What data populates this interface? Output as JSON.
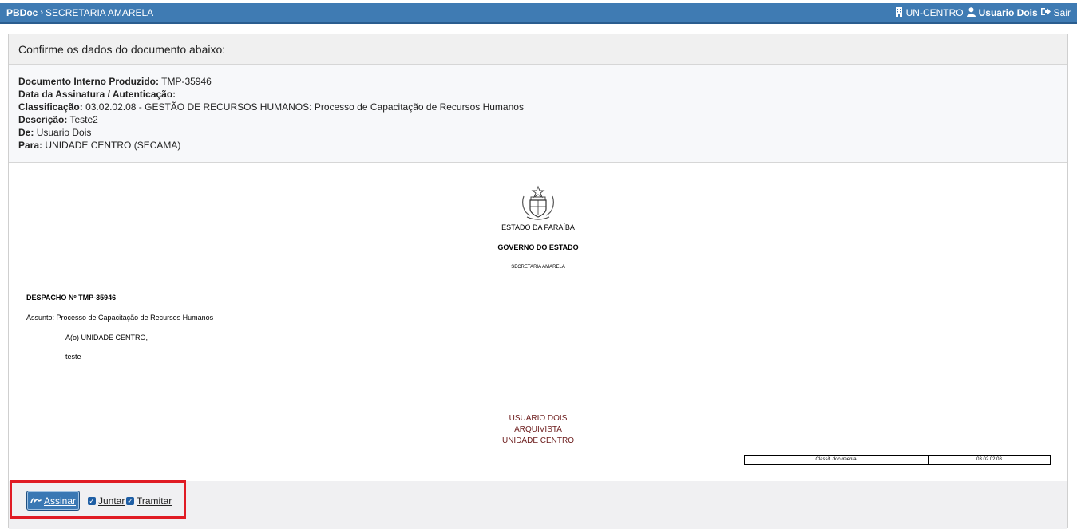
{
  "topbar": {
    "brand": "PBDoc",
    "section": "SECRETARIA AMARELA",
    "unit": "UN-CENTRO",
    "user": "Usuario Dois",
    "logout": "Sair"
  },
  "card": {
    "title": "Confirme os dados do documento abaixo:"
  },
  "meta": {
    "doc_label": "Documento Interno Produzido:",
    "doc_value": "TMP-35946",
    "date_label": "Data da Assinatura / Autenticação:",
    "class_label": "Classificação:",
    "class_value": "03.02.02.08 - GESTÃO DE RECURSOS HUMANOS: Processo de Capacitação de Recursos Humanos",
    "desc_label": "Descrição:",
    "desc_value": "Teste2",
    "from_label": "De:",
    "from_value": "Usuario Dois",
    "to_label": "Para:",
    "to_value": "UNIDADE CENTRO (SECAMA)"
  },
  "document": {
    "state": "ESTADO DA PARAÍBA",
    "government": "GOVERNO DO ESTADO",
    "secretariat": "SECRETARIA AMARELA",
    "despacho": "DESPACHO Nº TMP-35946",
    "assunto": "Assunto: Processo de Capacitação de Recursos Humanos",
    "recipient": "A(o) UNIDADE CENTRO,",
    "body": "teste",
    "sig_name": "USUARIO DOIS",
    "sig_role": "ARQUIVISTA",
    "sig_unit": "UNIDADE CENTRO",
    "classif_label": "Classif. documental",
    "classif_value": "03.02.02.08"
  },
  "actions": {
    "sign_label": "Assinar",
    "join_label": "Juntar",
    "forward_label": "Tramitar",
    "join_checked": true,
    "forward_checked": true
  }
}
